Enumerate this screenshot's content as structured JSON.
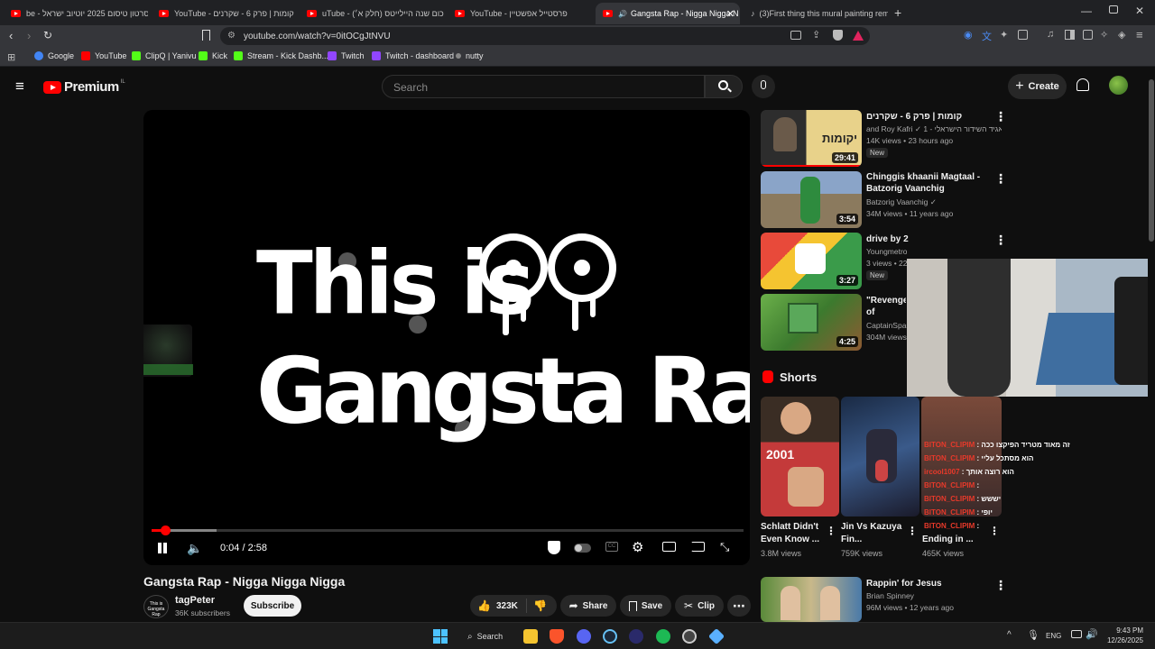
{
  "tabs": [
    {
      "label": "be - סרטון טיסום 2025 יוטיוב ישראל"
    },
    {
      "label": "YouTube - קומות | פרק 6 - שקרנים"
    },
    {
      "label": "uTube - סיכום שנה היילייטס (חלק א׳)"
    },
    {
      "label": "YouTube - פרסטייל אפשטיין"
    },
    {
      "label": "Gangsta Rap - Nigga Nigga N"
    },
    {
      "label": "(3)First thing this mural painting rem"
    }
  ],
  "address": {
    "url": "youtube.com/watch?v=0itOCgJtNVU"
  },
  "bookmarks": [
    {
      "label": "Google",
      "color": "#4285f4"
    },
    {
      "label": "YouTube",
      "color": "#ff0000"
    },
    {
      "label": "ClipQ | Yanivu",
      "color": "#53fc18"
    },
    {
      "label": "Kick",
      "color": "#53fc18"
    },
    {
      "label": "Stream - Kick Dashb...",
      "color": "#53fc18"
    },
    {
      "label": "Twitch",
      "color": "#9146ff"
    },
    {
      "label": "Twitch - dashboard",
      "color": "#9146ff"
    },
    {
      "label": "nutty",
      "color": "#888888"
    }
  ],
  "header": {
    "logo_text": "Premium",
    "logo_sup": "IL",
    "search_placeholder": "Search",
    "create_label": "Create"
  },
  "player": {
    "art_line1": "This is",
    "art_line2": "Gangsta Rap",
    "time": "0:04 / 2:58",
    "progress_fraction": 0.023
  },
  "video": {
    "title": "Gangsta Rap - Nigga Nigga Nigga",
    "channel": "tagPeter",
    "subscribers": "36K subscribers",
    "subscribe_label": "Subscribe",
    "likes": "323K",
    "share_label": "Share",
    "save_label": "Save",
    "clip_label": "Clip"
  },
  "recommendations": [
    {
      "title": "קומות | פרק 6 - שקרנים",
      "channel": "and Roy Kafri ✓ התאגיד השידור הישראלי - 1...",
      "meta": "14K views • 23 hours ago",
      "badge": "New",
      "duration": "29:41"
    },
    {
      "title": "Chinggis khaanii Magtaal - Batzorig Vaanchig",
      "channel": "Batzorig Vaanchig ✓",
      "meta": "34M views • 11 years ago",
      "badge": "",
      "duration": "3:54"
    },
    {
      "title": "drive by 2",
      "channel": "Youngmetrooo705",
      "meta": "3 views • 22",
      "badge": "New",
      "duration": "3:27"
    },
    {
      "title": "\"Revenge\" of Usher's",
      "channel": "CaptainSpar",
      "meta": "304M views",
      "badge": "",
      "duration": "4:25"
    }
  ],
  "shorts": {
    "heading": "Shorts",
    "items": [
      {
        "title": "Schlatt Didn't Even Know ...",
        "views": "3.8M views"
      },
      {
        "title": "Jin Vs Kazuya Fin...",
        "views": "759K views"
      },
      {
        "title": "Ending in ...",
        "views": "465K views"
      }
    ]
  },
  "rappin": {
    "title": "Rappin' for Jesus",
    "channel": "Brian Spinney",
    "meta": "96M views • 12 years ago"
  },
  "chat": [
    {
      "name": "BITON_CLIPIM",
      "msg": "זה מאוד מטריד הפיקצו ככה"
    },
    {
      "name": "BITON_CLIPIM",
      "msg": "הוא מסתכל עליי"
    },
    {
      "name": "ircool1007",
      "msg": "הוא רוצה אותך"
    },
    {
      "name": "BITON_CLIPIM",
      "msg": ""
    },
    {
      "name": "BITON_CLIPIM",
      "msg": "יששש"
    },
    {
      "name": "BITON_CLIPIM",
      "msg": "יופי"
    },
    {
      "name": "BITON_CLIPIM",
      "msg": ""
    }
  ],
  "taskbar": {
    "search_label": "Search",
    "lang": "ENG",
    "time": "9:43 PM",
    "date": "12/26/2025"
  }
}
